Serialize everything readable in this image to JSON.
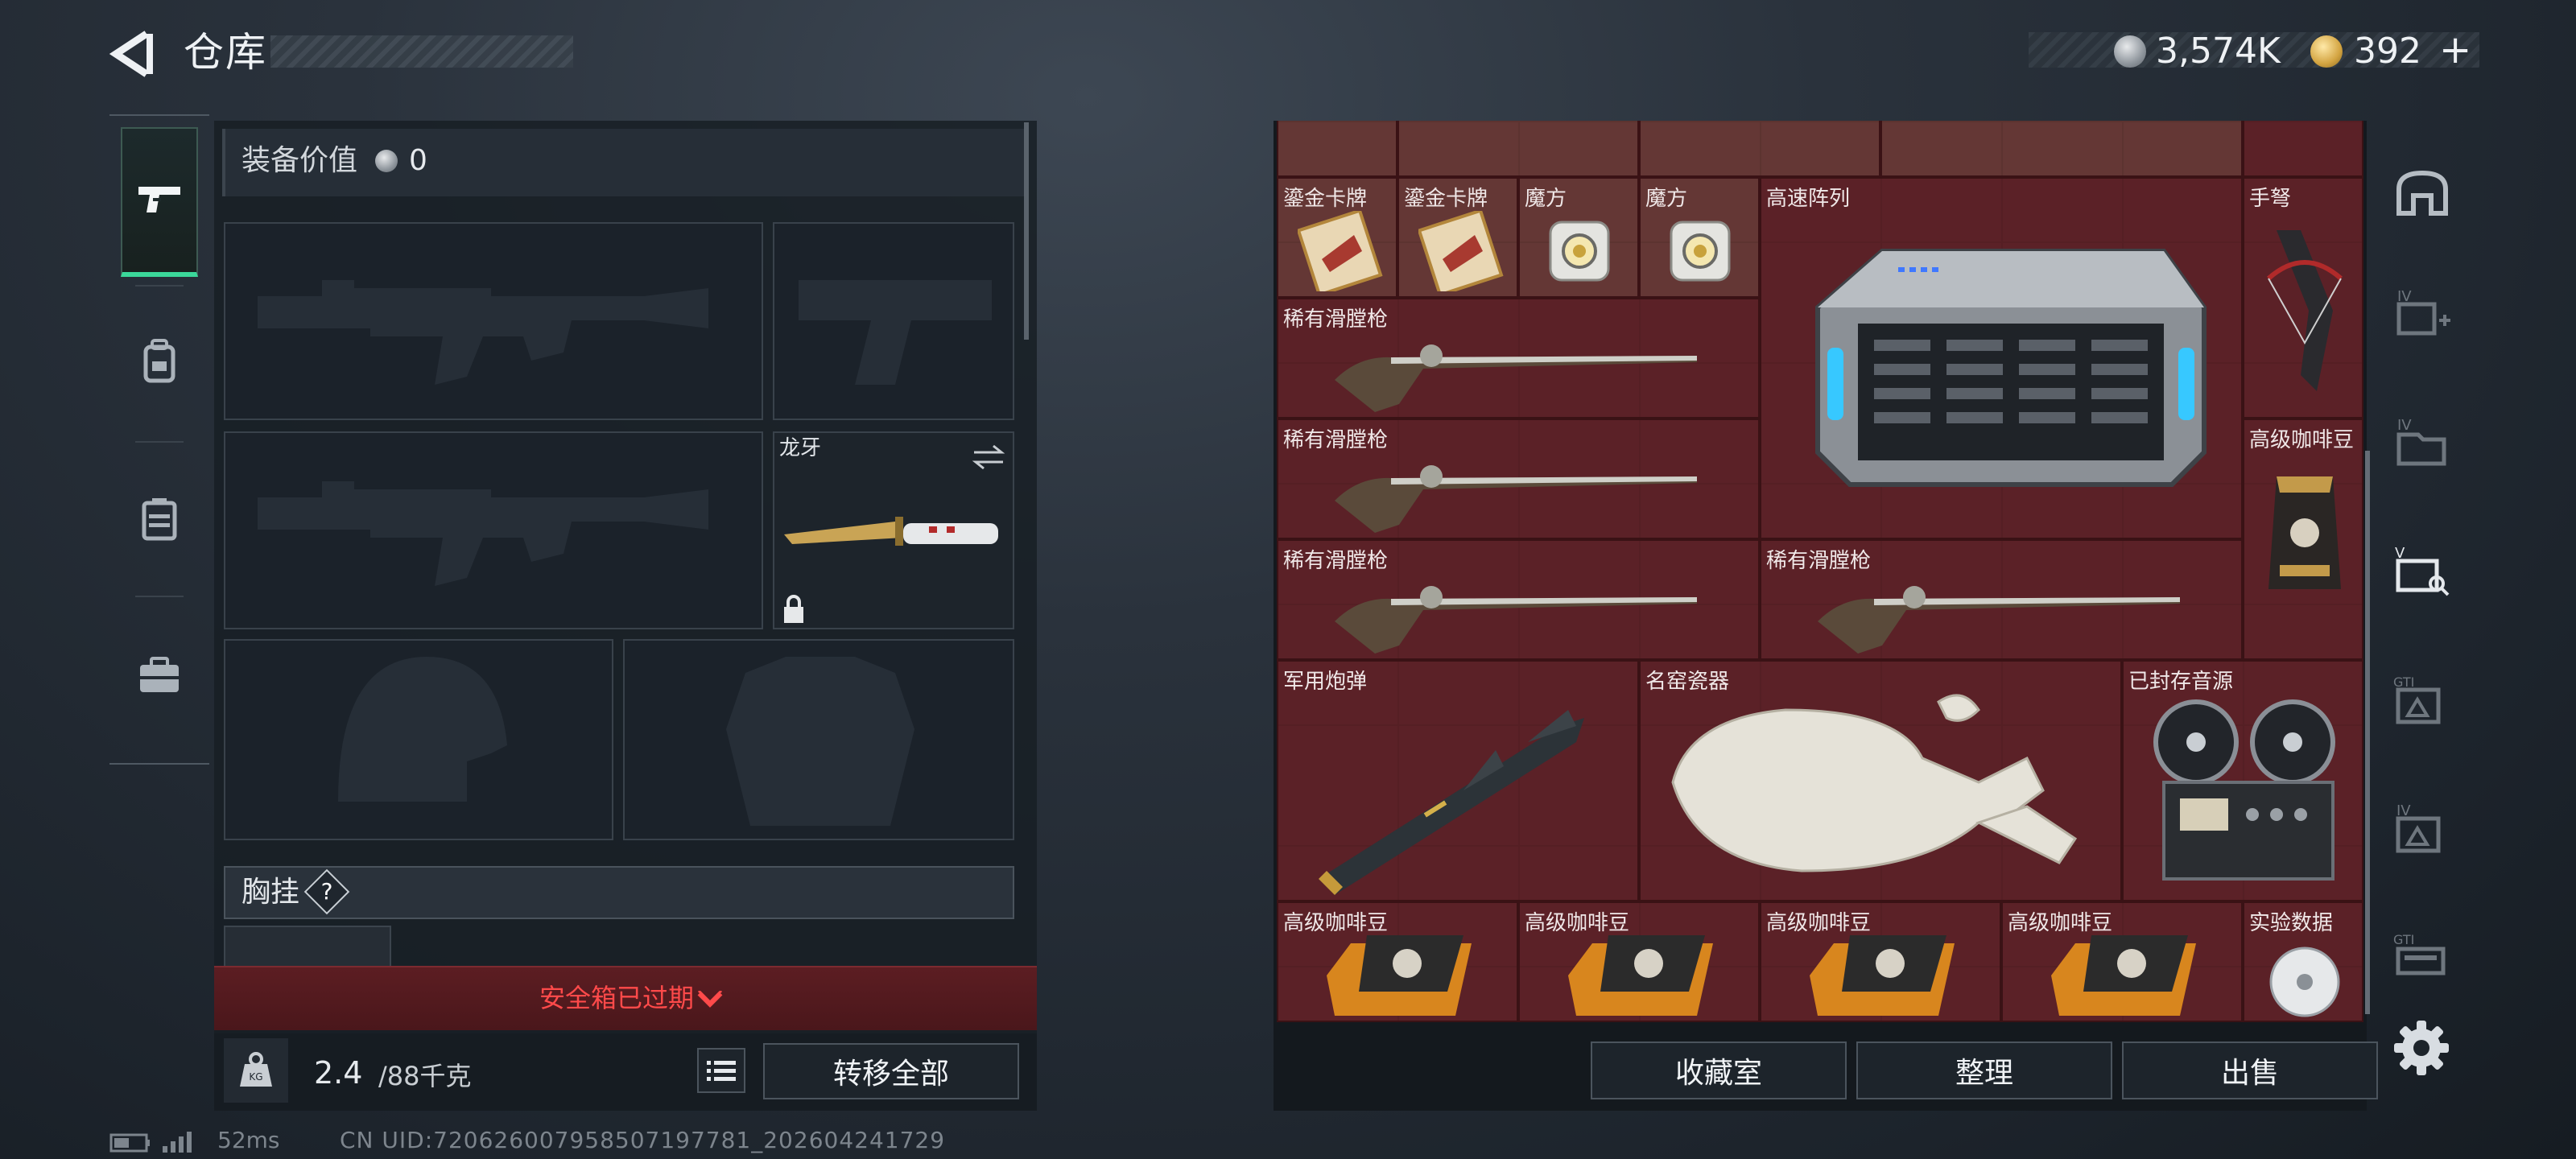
{
  "header": {
    "title": "仓库",
    "currency1": "3,574K",
    "currency2": "392",
    "currency2_plus": "+"
  },
  "loadout": {
    "value_label": "装备价值",
    "value_num": "0",
    "knife_name": "龙牙",
    "chest_label": "胸挂",
    "chest_help": "?",
    "expired": "安全箱已过期",
    "weight_current": "2.4",
    "weight_max": "/88千克",
    "transfer_all": "转移全部"
  },
  "grid": {
    "items": [
      {
        "label": "鎏金卡牌"
      },
      {
        "label": "鎏金卡牌"
      },
      {
        "label": "魔方"
      },
      {
        "label": "魔方"
      },
      {
        "label": "高速阵列"
      },
      {
        "label": "手弩"
      },
      {
        "label": "稀有滑膛枪"
      },
      {
        "label": "稀有滑膛枪"
      },
      {
        "label": "高级咖啡豆"
      },
      {
        "label": "稀有滑膛枪"
      },
      {
        "label": "稀有滑膛枪"
      },
      {
        "label": "军用炮弹"
      },
      {
        "label": "名窑瓷器"
      },
      {
        "label": "已封存音源"
      },
      {
        "label": "高级咖啡豆"
      },
      {
        "label": "高级咖啡豆"
      },
      {
        "label": "高级咖啡豆"
      },
      {
        "label": "高级咖啡豆"
      },
      {
        "label": "实验数据"
      }
    ]
  },
  "actions": {
    "collection": "收藏室",
    "sort": "整理",
    "sell": "出售"
  },
  "status": {
    "ping": "52ms",
    "uid": "CN UID:720626007958507197781_202604241729"
  },
  "colors": {
    "accent_green": "#3bd89a",
    "expired_red": "#ff4a4a",
    "grid_bg": "#5a2127"
  }
}
